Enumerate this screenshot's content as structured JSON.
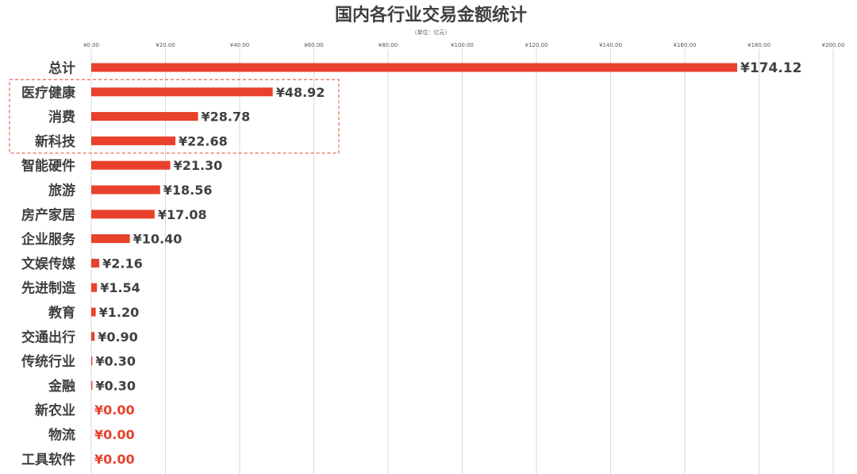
{
  "chart_data": {
    "type": "bar",
    "orientation": "horizontal",
    "title": "国内各行业交易金额统计",
    "subtitle": "（单位：亿元）",
    "xlim": [
      0,
      200
    ],
    "x_ticks": [
      0,
      20,
      40,
      60,
      80,
      100,
      120,
      140,
      160,
      180,
      200
    ],
    "x_tick_labels": [
      "¥0.00",
      "¥20.00",
      "¥40.00",
      "¥60.00",
      "¥80.00",
      "¥100.00",
      "¥120.00",
      "¥140.00",
      "¥160.00",
      "¥180.00",
      "¥200.00"
    ],
    "categories": [
      "总计",
      "医疗健康",
      "消费",
      "新科技",
      "智能硬件",
      "旅游",
      "房产家居",
      "企业服务",
      "文娱传媒",
      "先进制造",
      "教育",
      "交通出行",
      "传统行业",
      "金融",
      "新农业",
      "物流",
      "工具软件"
    ],
    "values": [
      174.12,
      48.92,
      28.78,
      22.68,
      21.3,
      18.56,
      17.08,
      10.4,
      2.16,
      1.54,
      1.2,
      0.9,
      0.3,
      0.3,
      0.0,
      0.0,
      0.0
    ],
    "value_labels": [
      "¥174.12",
      "¥48.92",
      "¥28.78",
      "¥22.68",
      "¥21.30",
      "¥18.56",
      "¥17.08",
      "¥10.40",
      "¥2.16",
      "¥1.54",
      "¥1.20",
      "¥0.90",
      "¥0.30",
      "¥0.30",
      "¥0.00",
      "¥0.00",
      "¥0.00"
    ],
    "highlighted_categories": [
      "医疗健康",
      "消费",
      "新科技"
    ],
    "grid": true,
    "legend": "none",
    "colors": {
      "bar": "#e8412c",
      "zero_label": "#e8412c",
      "text": "#404040",
      "grid": "#d9d9d9",
      "highlight_box": "#e8412c"
    }
  }
}
